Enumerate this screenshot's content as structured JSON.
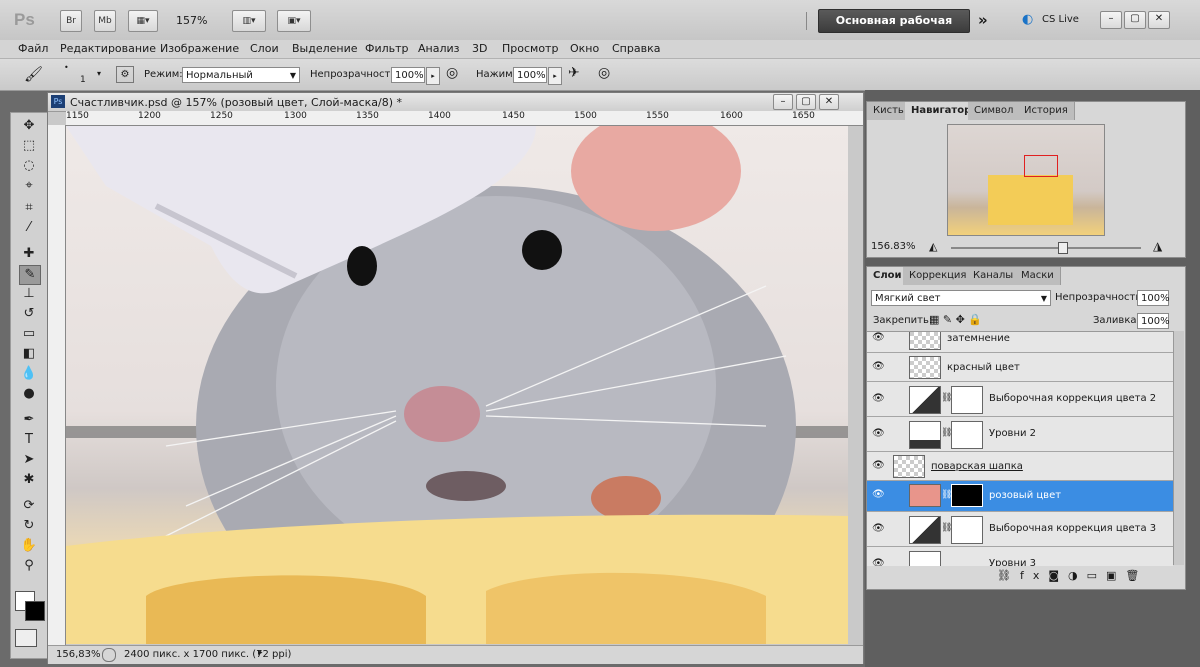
{
  "app": {
    "logo": "Ps",
    "bridge_btn": "Br",
    "minibridge_btn": "Mb",
    "zoom_level": "157%",
    "workspace": "Основная рабочая среда",
    "cslive": "CS Live"
  },
  "menu": [
    "Файл",
    "Редактирование",
    "Изображение",
    "Слои",
    "Выделение",
    "Фильтр",
    "Анализ",
    "3D",
    "Просмотр",
    "Окно",
    "Справка"
  ],
  "options": {
    "brush_size": "1",
    "mode_label": "Режим:",
    "mode_value": "Нормальный",
    "opacity_label": "Непрозрачность:",
    "opacity_value": "100%",
    "flow_label": "Нажим:",
    "flow_value": "100%"
  },
  "document": {
    "title": "Счастливчик.psd @ 157% (розовый цвет, Слой-маска/8) *",
    "ruler_ticks": [
      "1150",
      "1200",
      "1250",
      "1300",
      "1350",
      "1400",
      "1450",
      "1500",
      "1550",
      "1600",
      "1650"
    ],
    "zoom_status": "156,83%",
    "doc_info": "2400 пикс. x 1700 пикс. (72 ppi)"
  },
  "navigator": {
    "tabs": [
      "Кисть",
      "Навигатор",
      "Символ",
      "История"
    ],
    "active_tab": "Навигатор",
    "zoom": "156.83%"
  },
  "layers_panel": {
    "tabs": [
      "Слои",
      "Коррекция",
      "Каналы",
      "Маски"
    ],
    "blend_mode": "Мягкий свет",
    "opacity_label": "Непрозрачность:",
    "opacity_value": "100%",
    "lock_label": "Закрепить:",
    "fill_label": "Заливка:",
    "fill_value": "100%",
    "layers": [
      {
        "name": "затемнение",
        "type": "pixel"
      },
      {
        "name": "красный цвет",
        "type": "pixel"
      },
      {
        "name": "Выборочная коррекция цвета 2",
        "type": "adjustment"
      },
      {
        "name": "Уровни 2",
        "type": "levels"
      },
      {
        "name": "поварская шапка",
        "type": "pixel"
      },
      {
        "name": "розовый цвет",
        "type": "fill",
        "selected": true
      },
      {
        "name": "Выборочная коррекция цвета 3",
        "type": "adjustment"
      },
      {
        "name": "Уровни 3",
        "type": "levels"
      }
    ]
  },
  "icons": [
    "brush-icon",
    "eye-icon",
    "lock-icon",
    "chain-icon",
    "fx-icon",
    "mask-icon",
    "trash-icon",
    "hand-icon",
    "zoom-icon"
  ]
}
